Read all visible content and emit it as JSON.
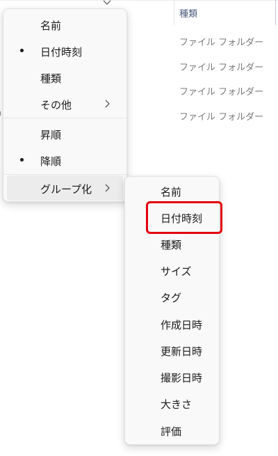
{
  "background": {
    "column_header": "種類",
    "rows": [
      "ファイル フォルダー",
      "ファイル フォルダー",
      "ファイル フォルダー",
      "ファイル フォルダー"
    ]
  },
  "main_menu": {
    "items": [
      {
        "label": "名前",
        "selected": false
      },
      {
        "label": "日付時刻",
        "selected": true
      },
      {
        "label": "種類",
        "selected": false
      },
      {
        "label": "その他",
        "selected": false,
        "has_submenu": true
      }
    ],
    "order_items": [
      {
        "label": "昇順",
        "selected": false
      },
      {
        "label": "降順",
        "selected": true
      }
    ],
    "group_item": {
      "label": "グループ化",
      "has_submenu": true,
      "hovered": true
    }
  },
  "group_submenu": {
    "items": [
      "名前",
      "日付時刻",
      "種類",
      "サイズ",
      "タグ",
      "作成日時",
      "更新日時",
      "撮影日時",
      "大きさ",
      "評価"
    ],
    "highlighted_item": "日付時刻"
  },
  "colors": {
    "highlight": "#e3000f",
    "menu_background": "#f9f9f9",
    "hover": "#ececec"
  }
}
